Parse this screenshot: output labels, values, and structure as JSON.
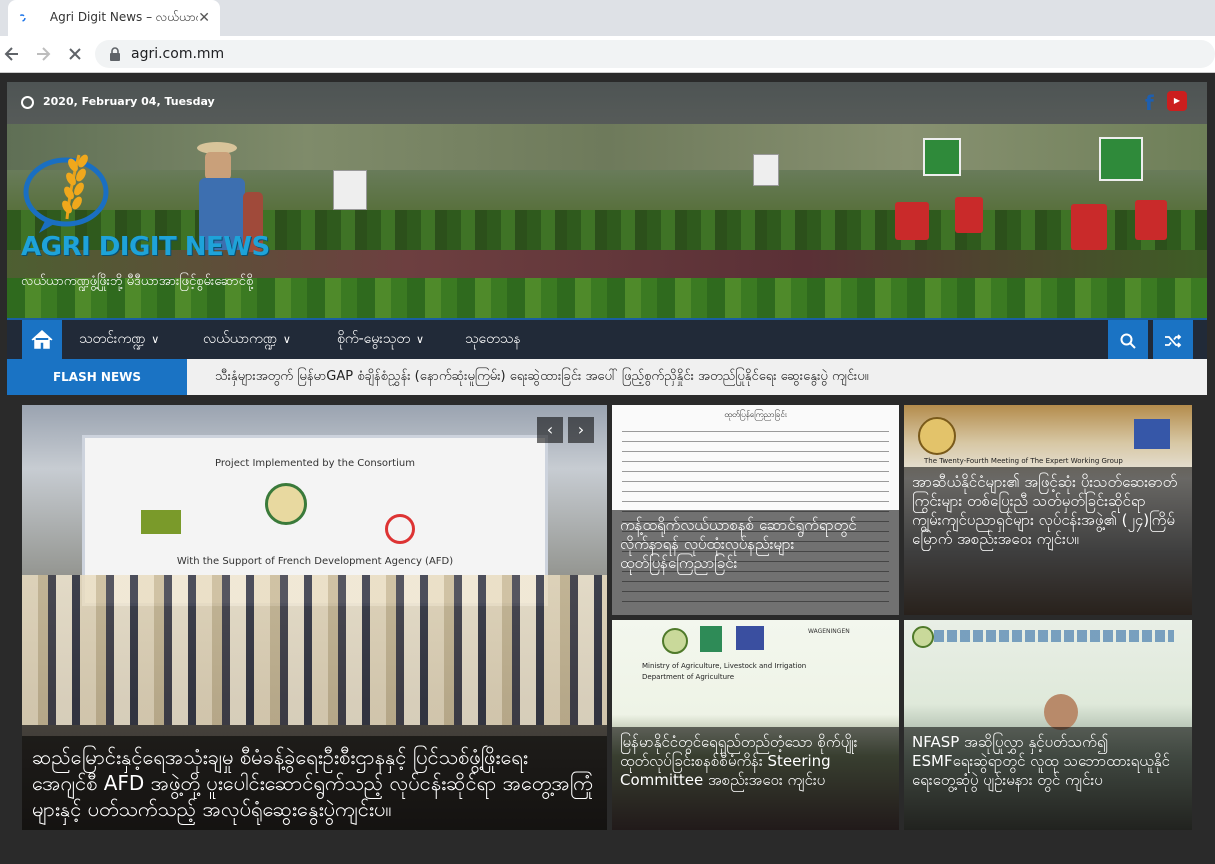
{
  "browser": {
    "tab_title": "Agri Digit News – လယ်ယာကဏ္ဍ",
    "url": "agri.com.mm"
  },
  "header": {
    "date": "2020, February 04, Tuesday",
    "site_title": "AGRI DIGIT NEWS",
    "tagline": "လယ်ယာကဏ္ဍဖွံ့ဖြိုးဘို့ မီဒီယာအားဖြင့်စွမ်းဆောင်စို့"
  },
  "nav": {
    "items": [
      {
        "label": "သတင်းကဏ္ဍ",
        "dropdown": true
      },
      {
        "label": "လယ်ယာကဏ္ဍ",
        "dropdown": true
      },
      {
        "label": "စိုက်-မွေးသုတ",
        "dropdown": true
      },
      {
        "label": "သုတေသန",
        "dropdown": false
      }
    ]
  },
  "flash": {
    "label": "FLASH NEWS",
    "text": "သီးနှံများအတွက် မြန်မာGAP စံချိန်စံညွှန်း (နောက်ဆုံးမူကြမ်း) ရေးဆွဲထားခြင်း အပေါ် ဖြည့်စွက်ညှိနှိုင်း အတည်ပြုနိုင်ရေး ဆွေးနွေးပွဲ ကျင်းပ။"
  },
  "features": {
    "main": {
      "caption": "ဆည်မြောင်းနှင့်ရေအသုံးချမှု စီမံခန့်ခွဲရေးဦးစီးဌာနနှင့် ပြင်သစ်ဖွံ့ဖြိုးရေး အေဂျင်စီ AFD အဖွဲ့တို့ ပူးပေါင်းဆောင်ရွက်သည့် လုပ်ငန်းဆိုင်ရာ အတွေ့အကြုံများနှင့် ပတ်သက်သည့် အလုပ်ရုံဆွေးနွေးပွဲကျင်းပ။",
      "banner_line1": "Project Implemented by the Consortium",
      "banner_line2": "With the Support of French Development Agency (AFD)"
    },
    "top_mid": {
      "caption": "ကန့်ထရိုက်လယ်ယာစနစ် ဆောင်ရွက်ရာတွင် လိုက်နာရန် လုပ်ထုံးလုပ်နည်းများ ထုတ်ပြန်ကြေညာခြင်း",
      "doc_heading": "ထုတ်ပြန်ကြေညာခြင်း"
    },
    "top_right": {
      "caption": "အာဆီယံနိုင်ငံများ၏ အဖြင့်ဆုံး ပိုးသတ်ဆေးဓာတ်ကြွင်းများ တစ်ပြေးညီ သတ်မှတ်ခြင်းဆိုင်ရာ ကျွမ်းကျင်ပညာရှင်များ လုပ်ငန်းအဖွဲ့၏ (၂၄)ကြိမ်မြောက် အစည်းအဝေး ကျင်းပ။",
      "banner": "The Twenty-Fourth Meeting of The Expert Working Group"
    },
    "bottom_mid": {
      "caption": "မြန်မာနိုင်ငံတွင်ရေရှည်တည်တံ့သော စိုက်ပျိုးထုတ်လုပ်ခြင်းစနစ်စီမံကိန်း Steering Committee အစည်းအဝေး ကျင်းပ",
      "banner1": "Ministry of Agriculture, Livestock and Irrigation",
      "banner2": "Department of Agriculture",
      "logo_label": "WAGENINGEN"
    },
    "bottom_right": {
      "caption": "NFASP အဆိုပြုလွှာ နှင့်ပတ်သက်၍ ESMFရေးဆွဲရာတွင် လူထု သဘောထားရယူနိုင်ရေးတွေ့ဆုံပွဲ ပျဉ်းမနား တွင် ကျင်းပ"
    }
  }
}
